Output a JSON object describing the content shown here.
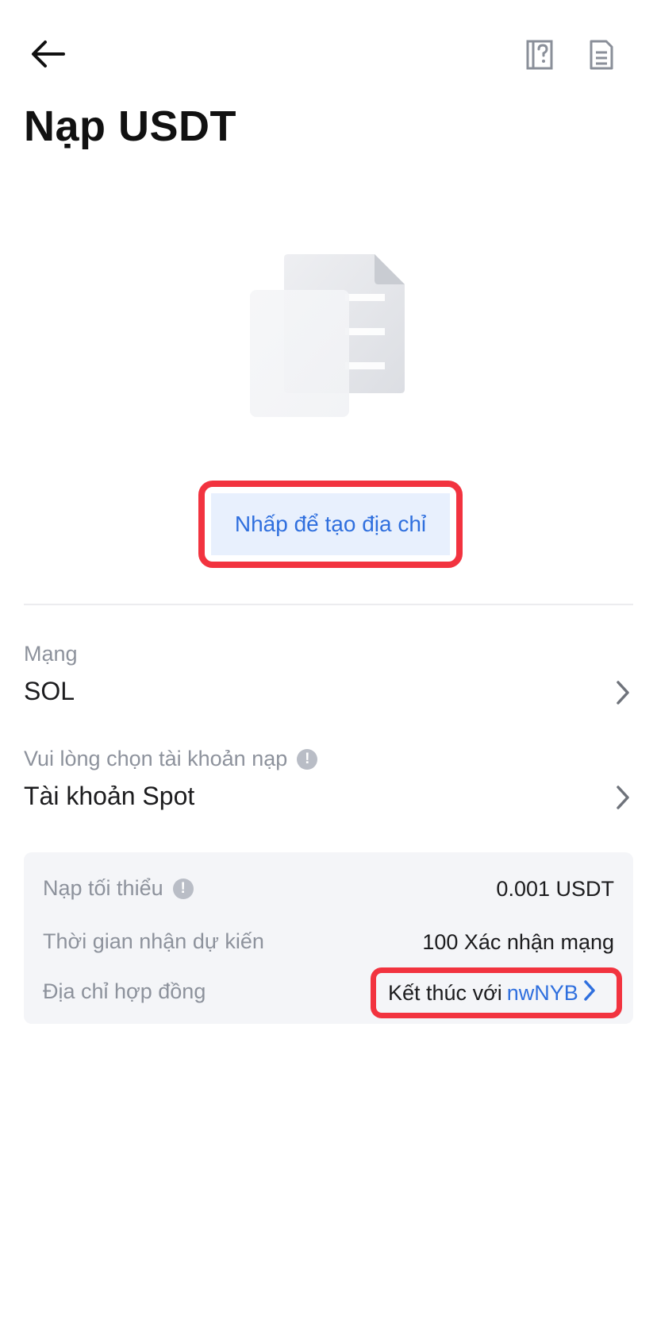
{
  "header": {
    "back_icon": "arrow-left-icon",
    "help_icon": "help-book-icon",
    "record_icon": "document-list-icon",
    "title": "Nạp USDT"
  },
  "illustration": {
    "icon": "empty-documents-illustration"
  },
  "generate": {
    "button_label": "Nhấp để tạo địa chỉ"
  },
  "network": {
    "label": "Mạng",
    "value": "SOL"
  },
  "account": {
    "label": "Vui lòng chọn tài khoản nạp",
    "value": "Tài khoản Spot"
  },
  "info": {
    "min_deposit_label": "Nạp tối thiểu",
    "min_deposit_value": "0.001 USDT",
    "arrival_label": "Thời gian nhận dự kiến",
    "arrival_value": "100 Xác nhận mạng",
    "contract_label": "Địa chỉ hợp đồng",
    "contract_prefix": "Kết thúc với",
    "contract_suffix": "nwNYB"
  },
  "colors": {
    "accent": "#2f6fde",
    "highlight": "#f2333f",
    "card_bg": "#f4f5f8",
    "muted_text": "#8d929c"
  }
}
